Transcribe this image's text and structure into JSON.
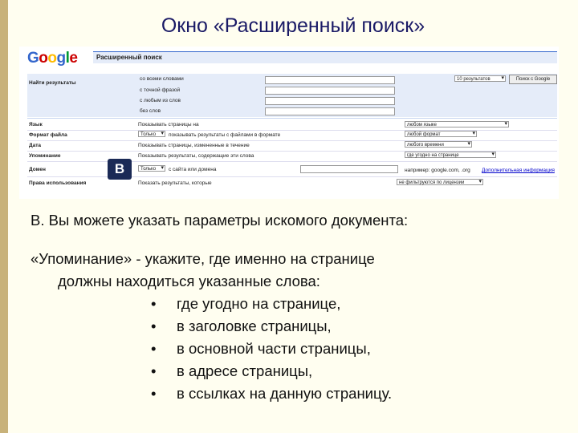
{
  "slide": {
    "title": "Окно «Расширенный поиск»",
    "badge": "B",
    "intro": "B. Вы можете указать параметры искомого документа:",
    "mention_line1": "«Упоминание» - укажите, где именно на странице",
    "mention_line2": "должны находиться указанные слова:",
    "bullets": [
      "где угодно на странице,",
      "в заголовке страницы,",
      "в основной части страницы,",
      "в адресе страницы,",
      "в ссылках на данную страницу."
    ],
    "bullet_symbol": "•"
  },
  "google": {
    "logo_letters": [
      "G",
      "o",
      "o",
      "g",
      "l",
      "e"
    ],
    "logo_colors": [
      "#3366cc",
      "#cc0000",
      "#ffbb00",
      "#3366cc",
      "#009933",
      "#cc0000"
    ],
    "page_title": "Расширенный поиск",
    "find_label": "Найти результаты",
    "find_options": [
      "со всеми словами",
      "с точной фразой",
      "с любым из слов",
      "без слов"
    ],
    "results_count": "10 результатов",
    "search_button": "Поиск с Google",
    "rows": [
      {
        "label": "Язык",
        "text": "Показывать страницы на",
        "select": "любом языке"
      },
      {
        "label": "Формат файла",
        "sel_left": "Только",
        "text": "показывать результаты с файлами в формате",
        "select": "любой формат"
      },
      {
        "label": "Дата",
        "text": "Показывать страницы, измененные в течение",
        "select": "любого времени"
      },
      {
        "label": "Упоминание",
        "text": "Показывать результаты, содержащие эти слова",
        "select": "где угодно на странице"
      },
      {
        "label": "Домен",
        "sel_left": "Только",
        "text": "с сайта или домена",
        "hint": "например: google.com, .org",
        "link": "Дополнительная информация"
      },
      {
        "label": "Права использования",
        "text": "Показать результаты, которые",
        "select": "не фильтруются по лицензии"
      }
    ]
  }
}
